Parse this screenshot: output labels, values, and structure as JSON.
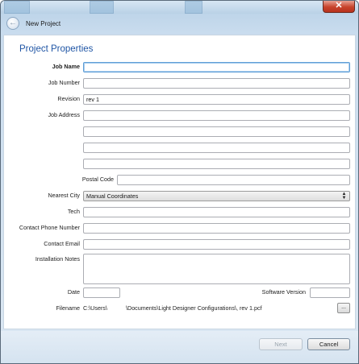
{
  "window": {
    "title": "New Project",
    "close_glyph": "✕"
  },
  "page": {
    "heading": "Project Properties"
  },
  "labels": {
    "job_name": "Job Name",
    "job_number": "Job Number",
    "revision": "Revision",
    "job_address": "Job Address",
    "postal_code": "Postal Code",
    "nearest_city": "Nearest City",
    "tech": "Tech",
    "contact_phone": "Contact Phone Number",
    "contact_email": "Contact Email",
    "installation_notes": "Installation Notes",
    "date": "Date",
    "software_version": "Software Version",
    "filename": "Filename"
  },
  "values": {
    "job_name": "",
    "job_number": "",
    "revision": "rev 1",
    "address_lines": [
      "",
      "",
      "",
      ""
    ],
    "postal_code": "",
    "nearest_city": "Manual Coordinates",
    "tech": "",
    "contact_phone": "",
    "contact_email": "",
    "installation_notes": "",
    "date": "",
    "software_version": "",
    "filename_part1": "C:\\Users\\",
    "filename_part2": "\\Documents\\Light Designer Configurations\\, rev 1.pcf"
  },
  "buttons": {
    "browse": "...",
    "next": "Next",
    "cancel": "Cancel"
  },
  "icons": {
    "back": "back-arrow-icon",
    "close": "close-icon",
    "combo": "updown-arrow-icon"
  }
}
